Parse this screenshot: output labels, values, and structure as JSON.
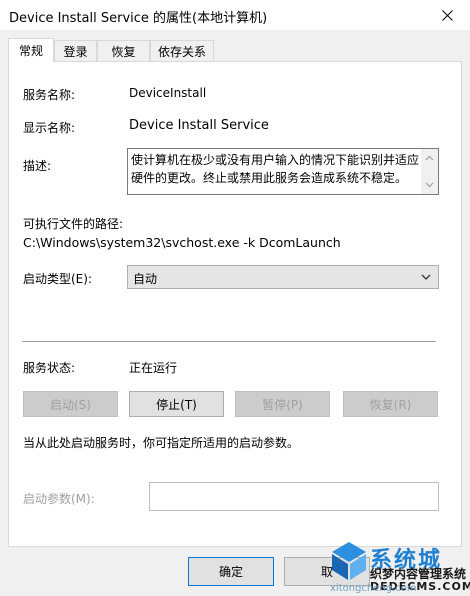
{
  "window": {
    "title": "Device Install Service 的属性(本地计算机)"
  },
  "tabs": [
    {
      "label": "常规"
    },
    {
      "label": "登录"
    },
    {
      "label": "恢复"
    },
    {
      "label": "依存关系"
    }
  ],
  "general": {
    "service_name_label": "服务名称:",
    "service_name_value": "DeviceInstall",
    "display_name_label": "显示名称:",
    "display_name_value": "Device Install Service",
    "description_label": "描述:",
    "description_value": "使计算机在极少或没有用户输入的情况下能识别并适应硬件的更改。终止或禁用此服务会造成系统不稳定。",
    "exe_path_label": "可执行文件的路径:",
    "exe_path_value": "C:\\Windows\\system32\\svchost.exe -k DcomLaunch",
    "startup_type_label": "启动类型(E):",
    "startup_type_value": "自动",
    "status_label": "服务状态:",
    "status_value": "正在运行",
    "start_button": "启动(S)",
    "stop_button": "停止(T)",
    "pause_button": "暂停(P)",
    "resume_button": "恢复(R)",
    "hint_text": "当从此处启动服务时，你可指定所适用的启动参数。",
    "start_params_label": "启动参数(M):",
    "start_params_value": ""
  },
  "footer": {
    "ok_button": "确定",
    "cancel_button": "取"
  },
  "watermark": {
    "brand": "系统城",
    "url": "xitongcheng.com",
    "line2": "织梦内容管理系统",
    "line3": "DEDECMS.COM"
  }
}
